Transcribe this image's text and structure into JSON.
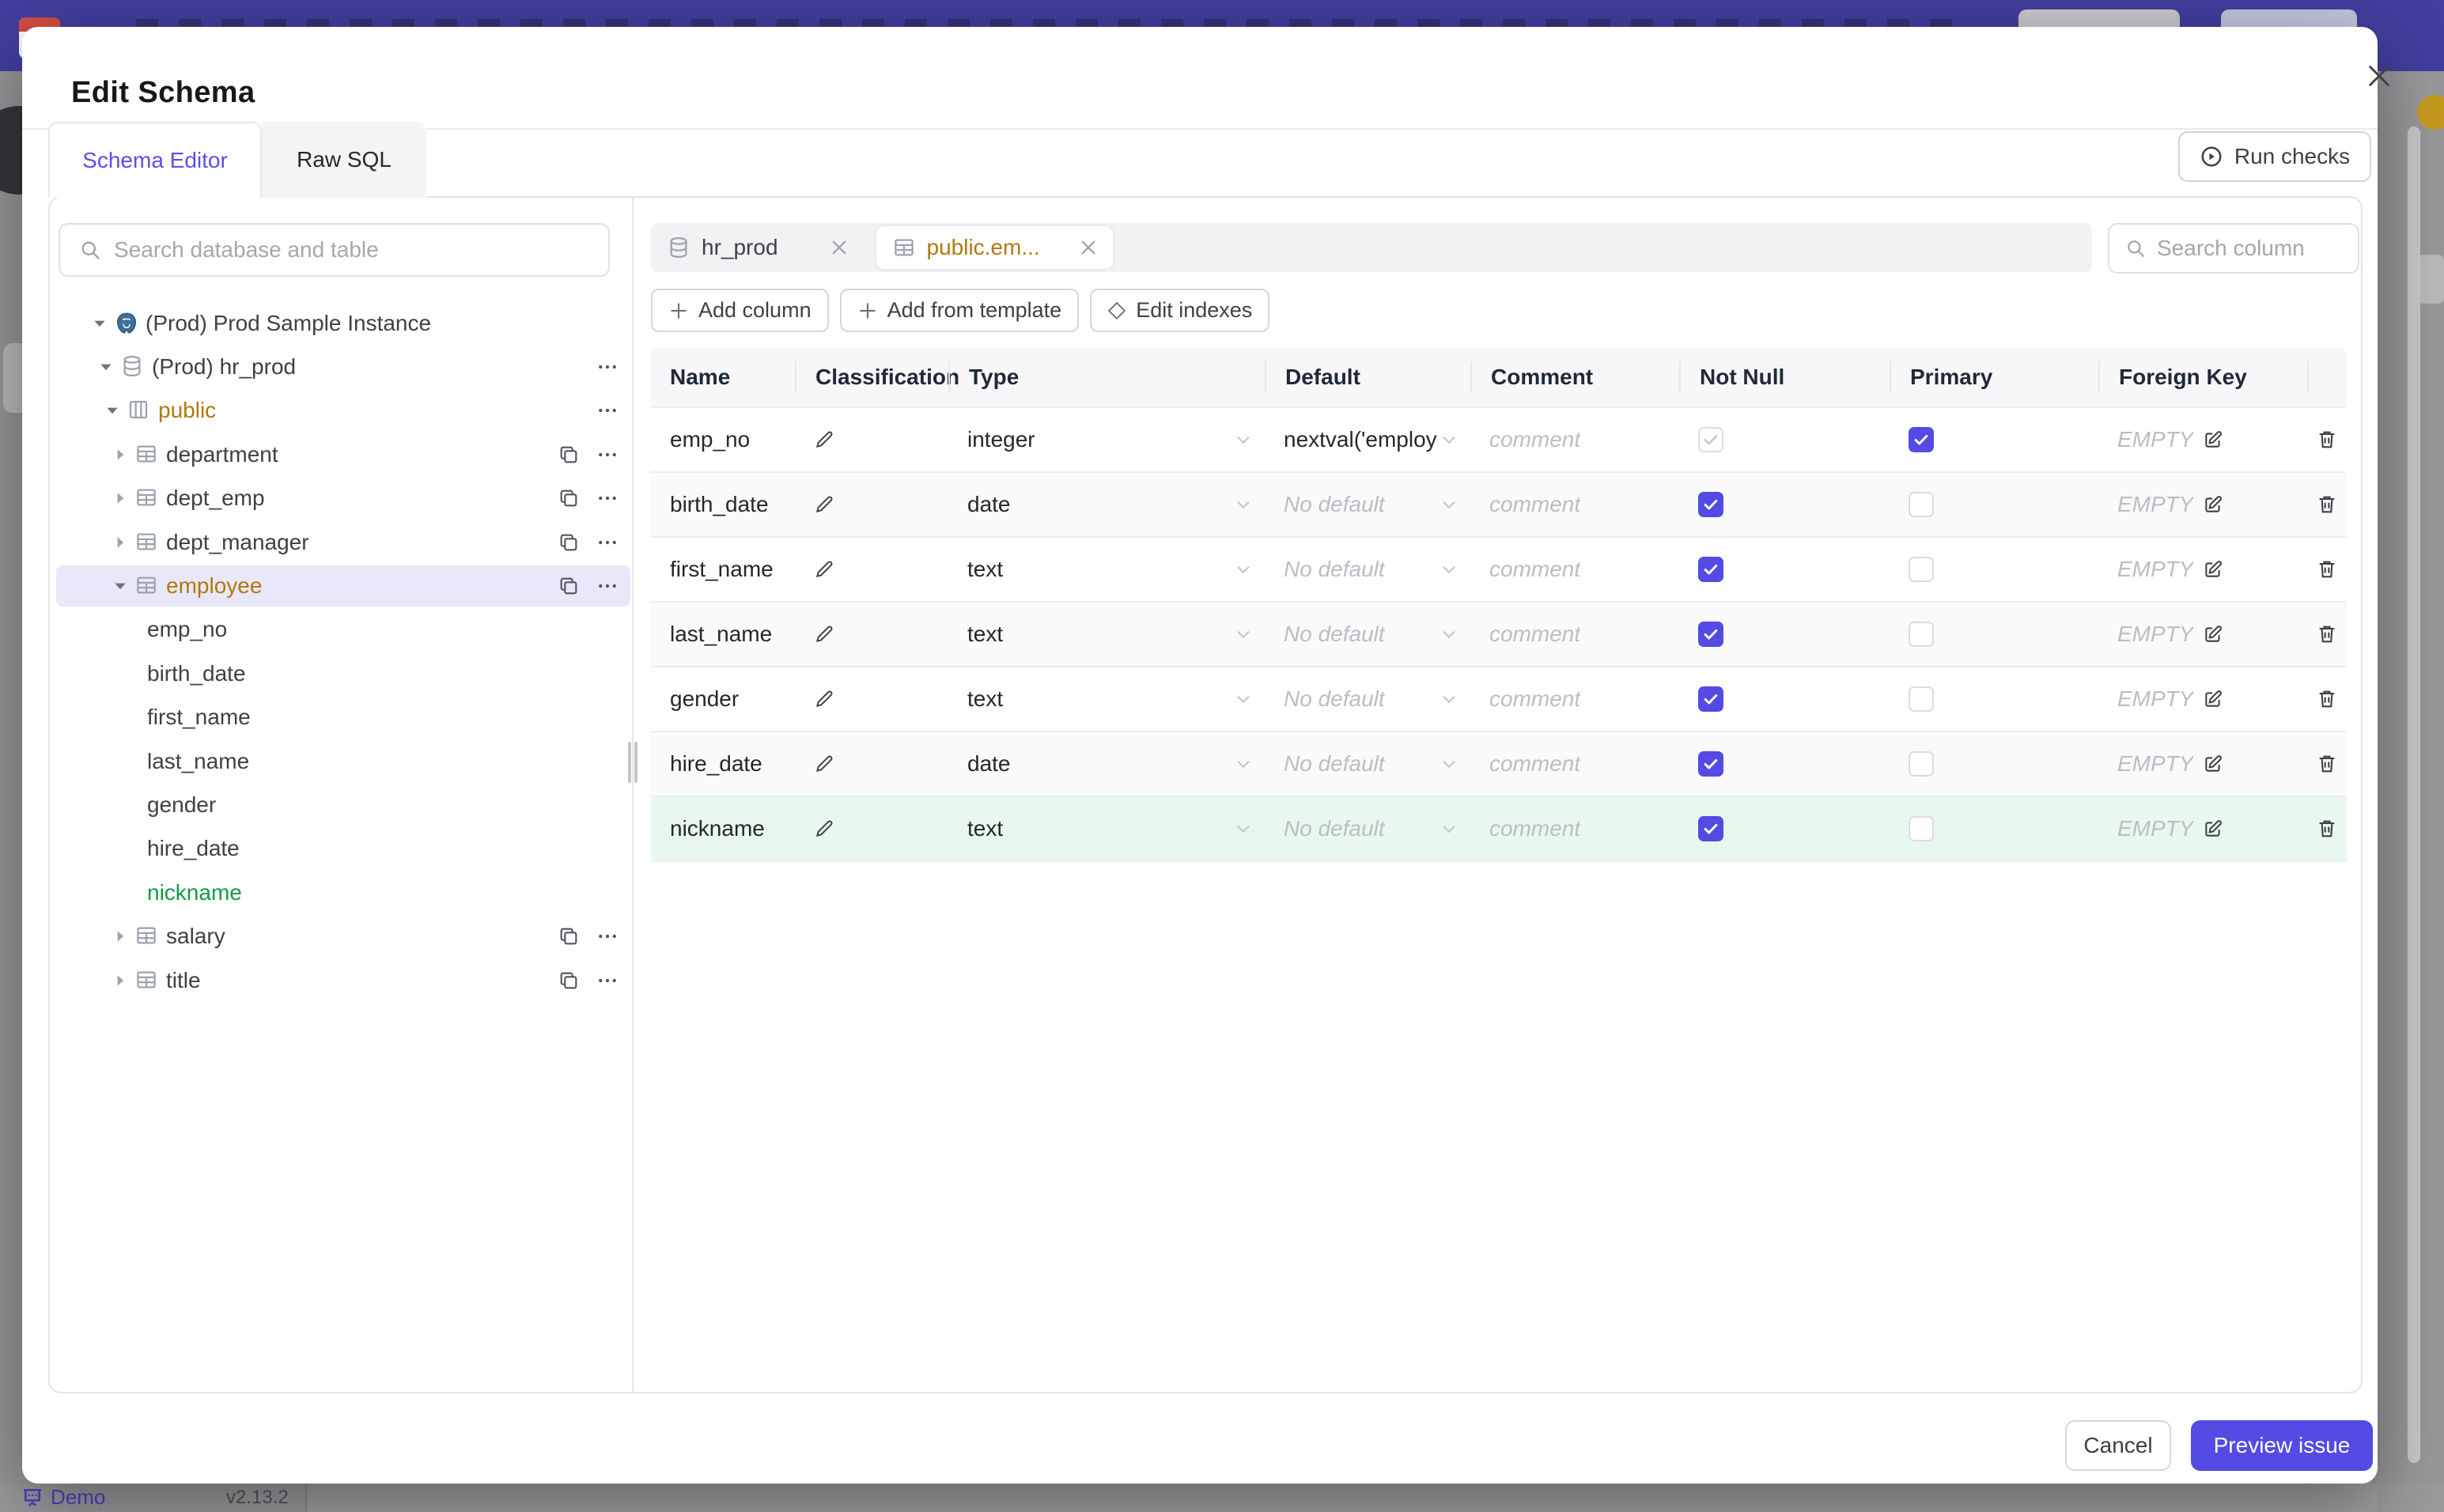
{
  "background": {
    "demo_label": "Demo",
    "version": "v2.13.2"
  },
  "modal": {
    "title": "Edit Schema",
    "tabs": [
      {
        "label": "Schema Editor",
        "active": true
      },
      {
        "label": "Raw SQL",
        "active": false
      }
    ],
    "run_checks_label": "Run checks",
    "footer": {
      "cancel_label": "Cancel",
      "primary_label": "Preview issue"
    }
  },
  "sidebar": {
    "search_placeholder": "Search database and table",
    "tree": [
      {
        "label": "(Prod) Prod Sample Instance",
        "icon": "postgres",
        "arrow": "expanded",
        "indent": 0,
        "color": "default",
        "actions": []
      },
      {
        "label": "(Prod) hr_prod",
        "icon": "database",
        "arrow": "expanded",
        "indent": 1,
        "color": "default",
        "actions": [
          "more"
        ]
      },
      {
        "label": "public",
        "icon": "schema",
        "arrow": "expanded",
        "indent": 2,
        "color": "amber",
        "actions": [
          "more"
        ]
      },
      {
        "label": "department",
        "icon": "table",
        "arrow": "collapsed",
        "indent": 3,
        "color": "default",
        "actions": [
          "copy",
          "more"
        ]
      },
      {
        "label": "dept_emp",
        "icon": "table",
        "arrow": "collapsed",
        "indent": 3,
        "color": "default",
        "actions": [
          "copy",
          "more"
        ]
      },
      {
        "label": "dept_manager",
        "icon": "table",
        "arrow": "collapsed",
        "indent": 3,
        "color": "default",
        "actions": [
          "copy",
          "more"
        ]
      },
      {
        "label": "employee",
        "icon": "table",
        "arrow": "expanded",
        "indent": 3,
        "color": "amber",
        "selected": true,
        "actions": [
          "copy",
          "more"
        ]
      },
      {
        "label": "emp_no",
        "icon": null,
        "arrow": null,
        "indent": "col",
        "color": "default",
        "actions": []
      },
      {
        "label": "birth_date",
        "icon": null,
        "arrow": null,
        "indent": "col",
        "color": "default",
        "actions": []
      },
      {
        "label": "first_name",
        "icon": null,
        "arrow": null,
        "indent": "col",
        "color": "default",
        "actions": []
      },
      {
        "label": "last_name",
        "icon": null,
        "arrow": null,
        "indent": "col",
        "color": "default",
        "actions": []
      },
      {
        "label": "gender",
        "icon": null,
        "arrow": null,
        "indent": "col",
        "color": "default",
        "actions": []
      },
      {
        "label": "hire_date",
        "icon": null,
        "arrow": null,
        "indent": "col",
        "color": "default",
        "actions": []
      },
      {
        "label": "nickname",
        "icon": null,
        "arrow": null,
        "indent": "col",
        "color": "green",
        "actions": []
      },
      {
        "label": "salary",
        "icon": "table",
        "arrow": "collapsed",
        "indent": 3,
        "color": "default",
        "actions": [
          "copy",
          "more"
        ]
      },
      {
        "label": "title",
        "icon": "table",
        "arrow": "collapsed",
        "indent": 3,
        "color": "default",
        "actions": [
          "copy",
          "more"
        ]
      }
    ]
  },
  "editor": {
    "chips": [
      {
        "label": "hr_prod",
        "icon": "database",
        "active": false
      },
      {
        "label": "public.em...",
        "icon": "table",
        "active": true
      }
    ],
    "search_placeholder": "Search column",
    "toolbar": [
      {
        "label": "Add column",
        "icon": "plus"
      },
      {
        "label": "Add from template",
        "icon": "plus"
      },
      {
        "label": "Edit indexes",
        "icon": "diamond"
      }
    ]
  },
  "table": {
    "columns": [
      "Name",
      "Classification",
      "Type",
      "Default",
      "Comment",
      "Not Null",
      "Primary",
      "Foreign Key",
      ""
    ],
    "comment_placeholder": "comment",
    "foreign_key_placeholder": "EMPTY",
    "rows": [
      {
        "name": "emp_no",
        "type": "integer",
        "default": "nextval('employ",
        "default_is_placeholder": false,
        "not_null_checked": true,
        "not_null_disabled": true,
        "primary_checked": true,
        "new": false
      },
      {
        "name": "birth_date",
        "type": "date",
        "default": "No default",
        "default_is_placeholder": true,
        "not_null_checked": true,
        "not_null_disabled": false,
        "primary_checked": false,
        "new": false
      },
      {
        "name": "first_name",
        "type": "text",
        "default": "No default",
        "default_is_placeholder": true,
        "not_null_checked": true,
        "not_null_disabled": false,
        "primary_checked": false,
        "new": false
      },
      {
        "name": "last_name",
        "type": "text",
        "default": "No default",
        "default_is_placeholder": true,
        "not_null_checked": true,
        "not_null_disabled": false,
        "primary_checked": false,
        "new": false
      },
      {
        "name": "gender",
        "type": "text",
        "default": "No default",
        "default_is_placeholder": true,
        "not_null_checked": true,
        "not_null_disabled": false,
        "primary_checked": false,
        "new": false
      },
      {
        "name": "hire_date",
        "type": "date",
        "default": "No default",
        "default_is_placeholder": true,
        "not_null_checked": true,
        "not_null_disabled": false,
        "primary_checked": false,
        "new": false
      },
      {
        "name": "nickname",
        "type": "text",
        "default": "No default",
        "default_is_placeholder": true,
        "not_null_checked": true,
        "not_null_disabled": false,
        "primary_checked": false,
        "new": true
      }
    ]
  },
  "colors": {
    "accent": "#544ae4",
    "tab_active_text": "#5b4ff0",
    "amber_modified": "#b1780e",
    "green_new": "#149a47",
    "topbar": "#433e9f",
    "new_row_bg": "#e9f8ee",
    "selected_tree_bg": "#e9e8fa"
  }
}
